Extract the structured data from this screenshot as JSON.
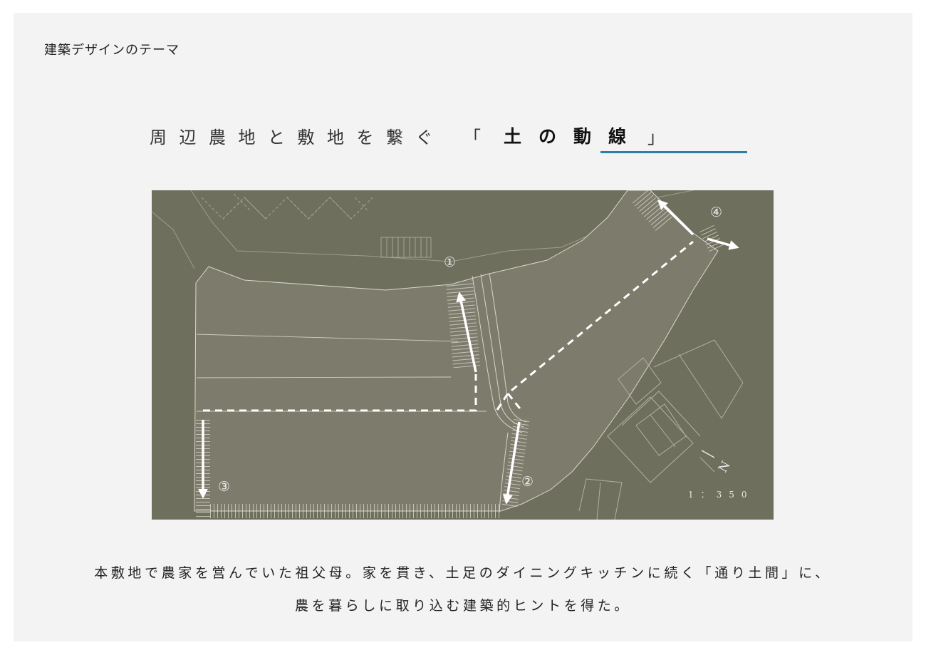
{
  "section_label": "建築デザインのテーマ",
  "headline": {
    "prefix": "周辺農地と敷地を繋ぐ",
    "bracket_open": "「",
    "keyword": "土の動線",
    "bracket_close": "」",
    "accent_color": "#2b7fa9"
  },
  "plan": {
    "background_color": "#6f6f5e",
    "site_color": "#7d7b6c",
    "route_color": "#ffffff",
    "markers": [
      "①",
      "②",
      "③",
      "④"
    ],
    "scale": "1：350",
    "north": "N"
  },
  "caption": {
    "line1": "本敷地で農家を営んでいた祖父母。家を貫き、土足のダイニングキッチンに続く「通り土間」に、",
    "line2": "農を暮らしに取り込む建築的ヒントを得た。"
  }
}
